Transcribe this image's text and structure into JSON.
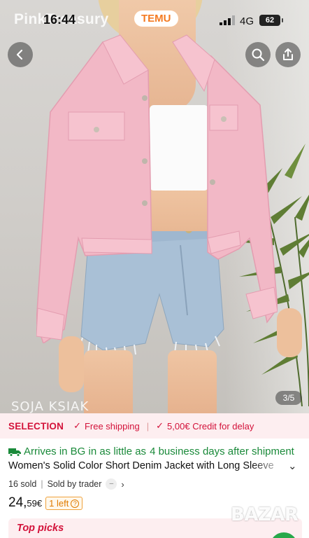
{
  "status_bar": {
    "shop_name": "PinkTreasury",
    "time": "16:44",
    "temu_badge": "TEMU",
    "network": "4G",
    "battery": "62"
  },
  "gallery": {
    "watermark": "SOJA KSIAK",
    "counter": "3/5"
  },
  "selection_strip": {
    "title": "SELECTION",
    "free_shipping": "Free shipping",
    "credit": "5,00€ Credit for delay"
  },
  "delivery": {
    "prefix": "Arrives in BG in as little as",
    "days": "4 business days after shipment"
  },
  "product": {
    "title": "Women's Solid Color Short Denim Jacket with Long Sleeve",
    "sold": "16 sold",
    "seller": "Sold by trader",
    "price_int": "24,",
    "price_dec": "59€",
    "stock_badge": "1 left"
  },
  "top_picks": "Top picks",
  "overlay_watermark": "BAZAR",
  "colors": {
    "accent_red": "#d3123a",
    "accent_green": "#1a8a3a",
    "temu_orange": "#f47a21",
    "jacket_pink": "#f2b8c6"
  },
  "icons": [
    "back-arrow-icon",
    "search-icon",
    "share-icon",
    "check-icon",
    "truck-icon",
    "chevron-down-icon",
    "chevron-right-icon",
    "info-icon"
  ]
}
